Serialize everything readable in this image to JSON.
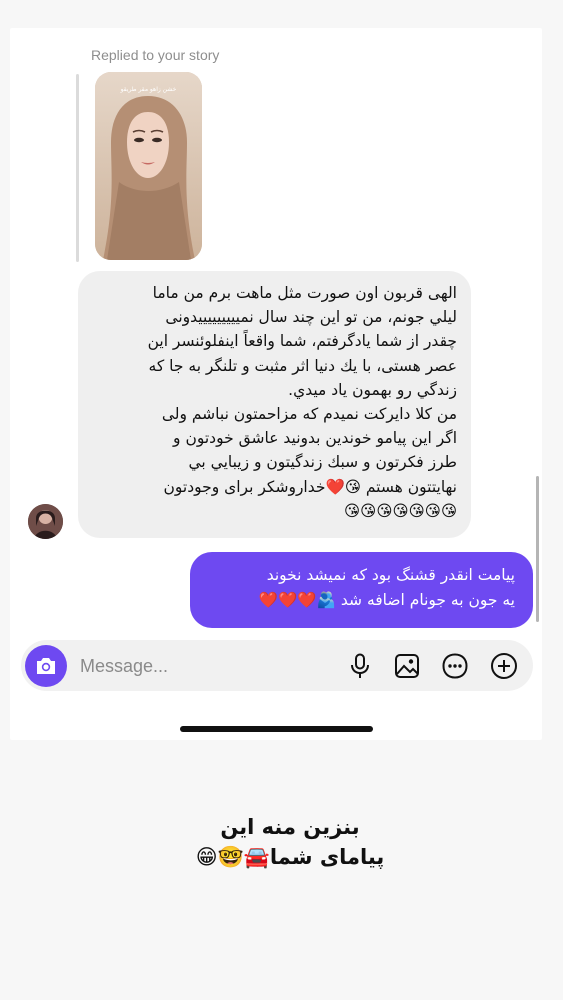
{
  "thread": {
    "replied_label": "Replied to your story",
    "story_caption": "خشن زاهو مقر طريقو"
  },
  "incoming_message": {
    "text": "الهى قربون اون صورت مثل ماهت برم من ماما\nليلي جونم، من تو اين چند سال نميييييييييدونى\nچقدر از شما يادگرفتم، شما واقعاً اينفلوئنسر اين\nعصر هستى، با يك دنيا اثر مثبت و تلنگر به جا كه\nزندگي رو بهمون ياد ميدي.\nمن كلا دايركت نميدم كه مزاحمتون نباشم ولى\nاگر اين پيامو خوندين بدونيد عاشق خودتون و\nطرز فكرتون و سبك زندگيتون و زيبايي بي\nنهايتتون هستم 😘❤️خداروشكر براى وجودتون\n😘😘😘😘😘😘😘"
  },
  "outgoing_message": {
    "text": "پيامت انقدر قشنگ بود كه نميشد نخوند\nيه جون به جونام اضافه شد 🫂❤️❤️❤️"
  },
  "composer": {
    "placeholder": "Message...",
    "icons": [
      "camera-icon",
      "microphone-icon",
      "image-icon",
      "sticker-icon",
      "plus-icon"
    ]
  },
  "overlay": {
    "caption": "بنزين منه اين\nپياماى شما🚘🤓😁"
  },
  "colors": {
    "accent": "#6e49f1",
    "incoming_bubble": "#efefef",
    "composer_bg": "#f1f1f1"
  }
}
